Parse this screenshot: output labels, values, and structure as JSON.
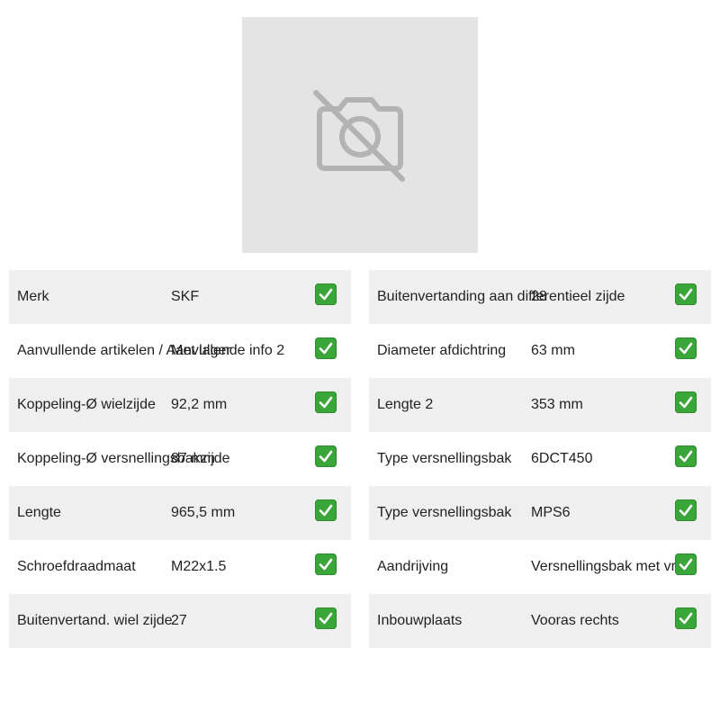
{
  "image": {
    "icon": "no-photo-camera-icon"
  },
  "colors": {
    "row_shade": "#efefef",
    "check": "#3aa63a",
    "placeholder_bg": "#e4e4e4"
  },
  "specs_left": [
    {
      "label": "Merk",
      "value": "SKF",
      "icon": "check-icon"
    },
    {
      "label": "Aanvullende artikelen / Aanvullende info 2",
      "value": "Met lager",
      "icon": "check-icon"
    },
    {
      "label": "Koppeling-Ø wielzijde",
      "value": "92,2 mm",
      "icon": "check-icon"
    },
    {
      "label": "Koppeling-Ø versnellingsbakzijde",
      "value": "87 mm",
      "icon": "check-icon"
    },
    {
      "label": "Lengte",
      "value": "965,5 mm",
      "icon": "check-icon"
    },
    {
      "label": "Schroefdraadmaat",
      "value": "M22x1.5",
      "icon": "check-icon"
    },
    {
      "label": "Buitenvertand. wiel zijde",
      "value": "27",
      "icon": "check-icon"
    }
  ],
  "specs_right": [
    {
      "label": "Buitenvertanding aan differentieel zijde",
      "value": "28",
      "icon": "check-icon"
    },
    {
      "label": "Diameter afdichtring",
      "value": "63 mm",
      "icon": "check-icon"
    },
    {
      "label": "Lengte 2",
      "value": "353 mm",
      "icon": "check-icon"
    },
    {
      "label": "Type versnellingsbak",
      "value": "6DCT450",
      "icon": "check-icon"
    },
    {
      "label": "Type versnellingsbak",
      "value": "MPS6",
      "icon": "check-icon"
    },
    {
      "label": "Aandrijving",
      "value": "Versnellingsbak met vrbo",
      "icon": "check-icon"
    },
    {
      "label": "Inbouwplaats",
      "value": "Vooras rechts",
      "icon": "check-icon"
    }
  ]
}
